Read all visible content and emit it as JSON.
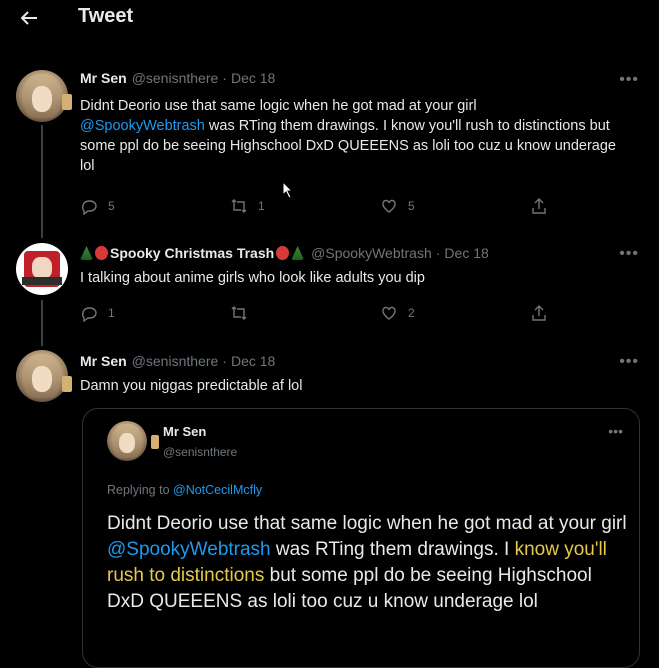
{
  "header": {
    "title": "Tweet"
  },
  "tweets": [
    {
      "name": "Mr Sen",
      "handle": "@senisnthere",
      "date": "Dec 18",
      "text_pre": "Didnt Deorio use that same logic when he got mad at your girl",
      "mention": "@SpookyWebtrash",
      "text_post": " was RTing them drawings. I know you'll rush to distinctions but some ppl do be seeing Highschool DxD QUEEENS as loli too cuz u know underage lol",
      "replies": "5",
      "retweets": "1",
      "likes": "5"
    },
    {
      "name": "Spooky Christmas Trash",
      "handle": "@SpookyWebtrash",
      "date": "Dec 18",
      "text": "I talking about anime girls who look like adults you dip",
      "replies": "1",
      "retweets": "",
      "likes": "2"
    },
    {
      "name": "Mr Sen",
      "handle": "@senisnthere",
      "date": "Dec 18",
      "text": "Damn you niggas predictable af lol"
    }
  ],
  "quote": {
    "name": "Mr Sen",
    "handle": "@senisnthere",
    "reply_prefix": "Replying to ",
    "reply_to": "@NotCecilMcfly",
    "text_pre": "Didnt Deorio use that same logic when he got mad at your girl ",
    "mention": "@SpookyWebtrash",
    "text_mid": " was RTing them drawings. I ",
    "highlight": "know you'll rush to distinctions",
    "text_post": " but some ppl do be seeing Highschool DxD QUEEENS as loli too cuz u know underage lol"
  },
  "more_label": "•••",
  "colors": {
    "accent": "#1d9bf0",
    "highlight": "#e6c84b",
    "background": "#000000"
  },
  "icons": [
    "back-arrow-icon",
    "reply-icon",
    "retweet-icon",
    "like-icon",
    "share-icon",
    "more-icon",
    "cursor-icon"
  ]
}
